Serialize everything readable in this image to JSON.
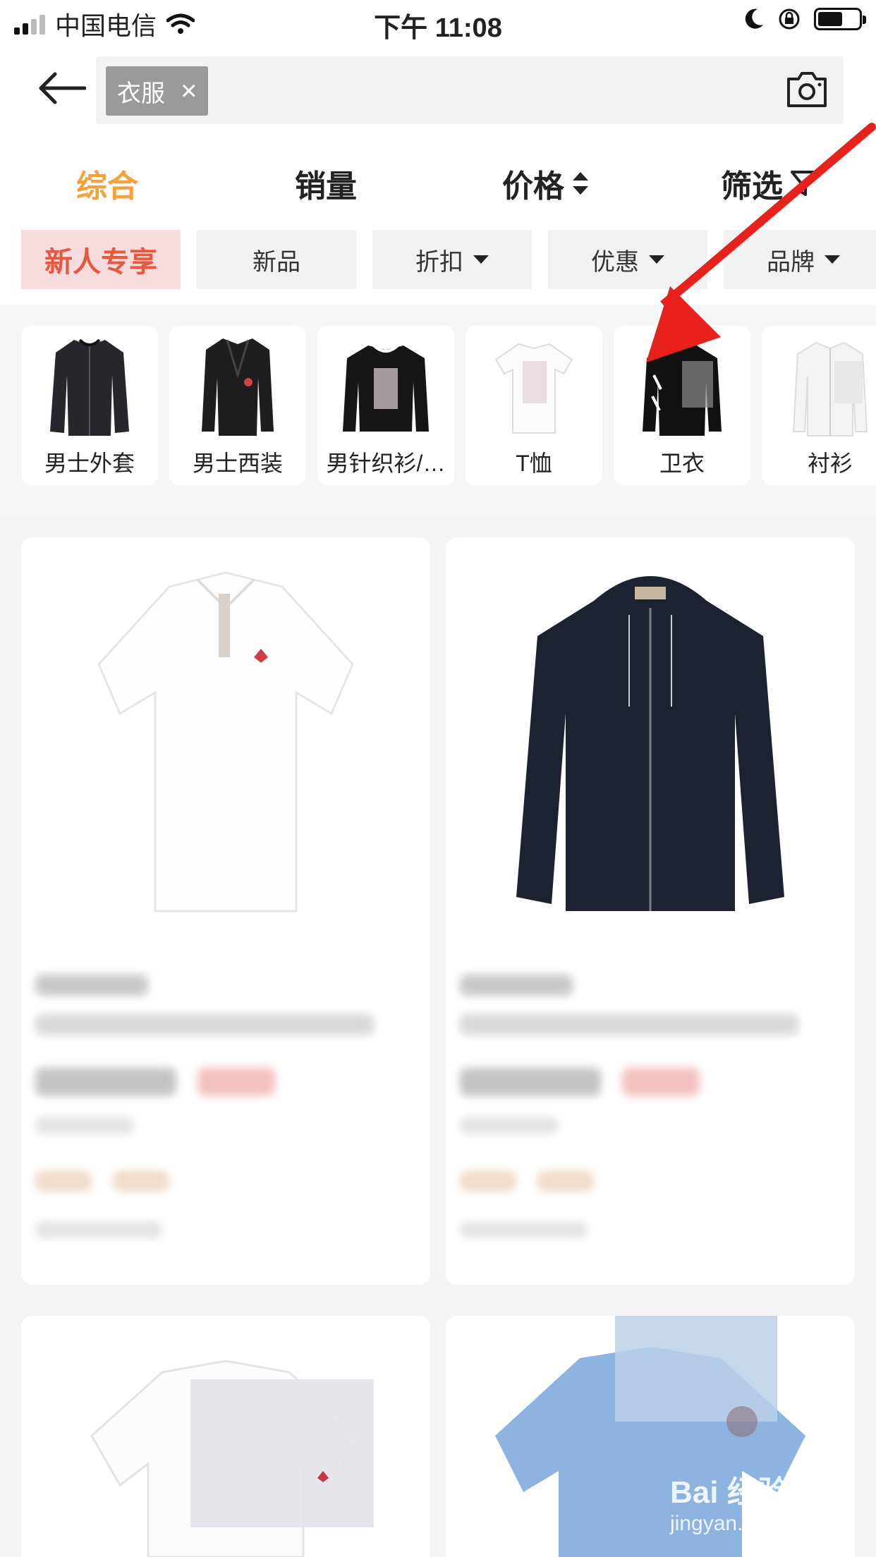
{
  "status": {
    "carrier": "中国电信",
    "time": "下午 11:08"
  },
  "search": {
    "tag": "衣服",
    "tag_close": "×"
  },
  "sort": {
    "items": [
      {
        "label": "综合"
      },
      {
        "label": "销量"
      },
      {
        "label": "价格"
      },
      {
        "label": "筛选"
      }
    ],
    "active_color": "#f5a13a"
  },
  "filters": {
    "items": [
      {
        "label": "新人专享"
      },
      {
        "label": "新品"
      },
      {
        "label": "折扣"
      },
      {
        "label": "优惠"
      },
      {
        "label": "品牌"
      }
    ]
  },
  "categories": {
    "items": [
      {
        "label": "男士外套"
      },
      {
        "label": "男士西装"
      },
      {
        "label": "男针织衫/…"
      },
      {
        "label": "T恤"
      },
      {
        "label": "卫衣"
      },
      {
        "label": "衬衫"
      }
    ]
  },
  "watermark": {
    "brand": "Bai 经验",
    "url": "jingyan.baidu.com"
  },
  "colors": {
    "accent": "#f5a13a",
    "hot_tag": "#e9573f",
    "annotation_arrow": "#e8211c"
  }
}
